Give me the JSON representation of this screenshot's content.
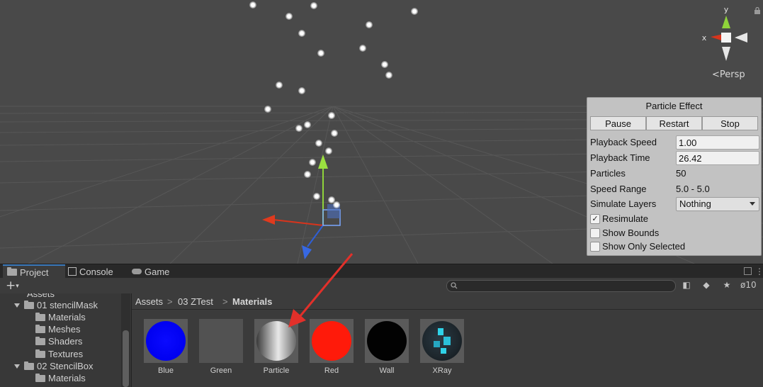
{
  "scene": {
    "view_label": "Persp",
    "gizmo_axes": {
      "y": "y",
      "x": "x"
    },
    "colors": {
      "background": "#494949",
      "grid": "#5a5a5a",
      "axis_x": "#d8341c",
      "axis_y": "#8fd33a",
      "axis_z": "#2f5fd6"
    }
  },
  "particle_effect": {
    "title": "Particle Effect",
    "buttons": [
      "Pause",
      "Restart",
      "Stop"
    ],
    "playback_speed_label": "Playback Speed",
    "playback_speed": "1.00",
    "playback_time_label": "Playback Time",
    "playback_time": "26.42",
    "particles_label": "Particles",
    "particles": "50",
    "speed_range_label": "Speed Range",
    "speed_range": "5.0 - 5.0",
    "simulate_layers_label": "Simulate Layers",
    "simulate_layers": "Nothing",
    "checkboxes": [
      {
        "label": "Resimulate",
        "checked": true,
        "mark": "✓"
      },
      {
        "label": "Show Bounds",
        "checked": false,
        "mark": ""
      },
      {
        "label": "Show Only Selected",
        "checked": false,
        "mark": ""
      }
    ]
  },
  "tabs": [
    {
      "label": "Project",
      "icon": "folder-icon",
      "active": true
    },
    {
      "label": "Console",
      "icon": "console-icon",
      "active": false
    },
    {
      "label": "Game",
      "icon": "game-icon",
      "active": false
    }
  ],
  "toolbar": {
    "add_label": "+",
    "hidden_count": "10"
  },
  "tree": {
    "top_label": "Assets",
    "items": [
      {
        "label": "01 stencilMask",
        "depth": 1,
        "expandable": true
      },
      {
        "label": "Materials",
        "depth": 2,
        "expandable": false
      },
      {
        "label": "Meshes",
        "depth": 2,
        "expandable": false
      },
      {
        "label": "Shaders",
        "depth": 2,
        "expandable": false
      },
      {
        "label": "Textures",
        "depth": 2,
        "expandable": false
      },
      {
        "label": "02 StencilBox",
        "depth": 1,
        "expandable": true
      },
      {
        "label": "Materials",
        "depth": 2,
        "expandable": false
      }
    ]
  },
  "breadcrumb": [
    "Assets",
    "03 ZTest",
    "Materials"
  ],
  "breadcrumb_separator": ">",
  "assets": [
    {
      "name": "Blue",
      "preview": "blue-sphere"
    },
    {
      "name": "Green",
      "preview": "empty"
    },
    {
      "name": "Particle",
      "preview": "gray-gradient-sphere"
    },
    {
      "name": "Red",
      "preview": "red-sphere"
    },
    {
      "name": "Wall",
      "preview": "black-sphere"
    },
    {
      "name": "XRay",
      "preview": "xray-sphere"
    }
  ]
}
